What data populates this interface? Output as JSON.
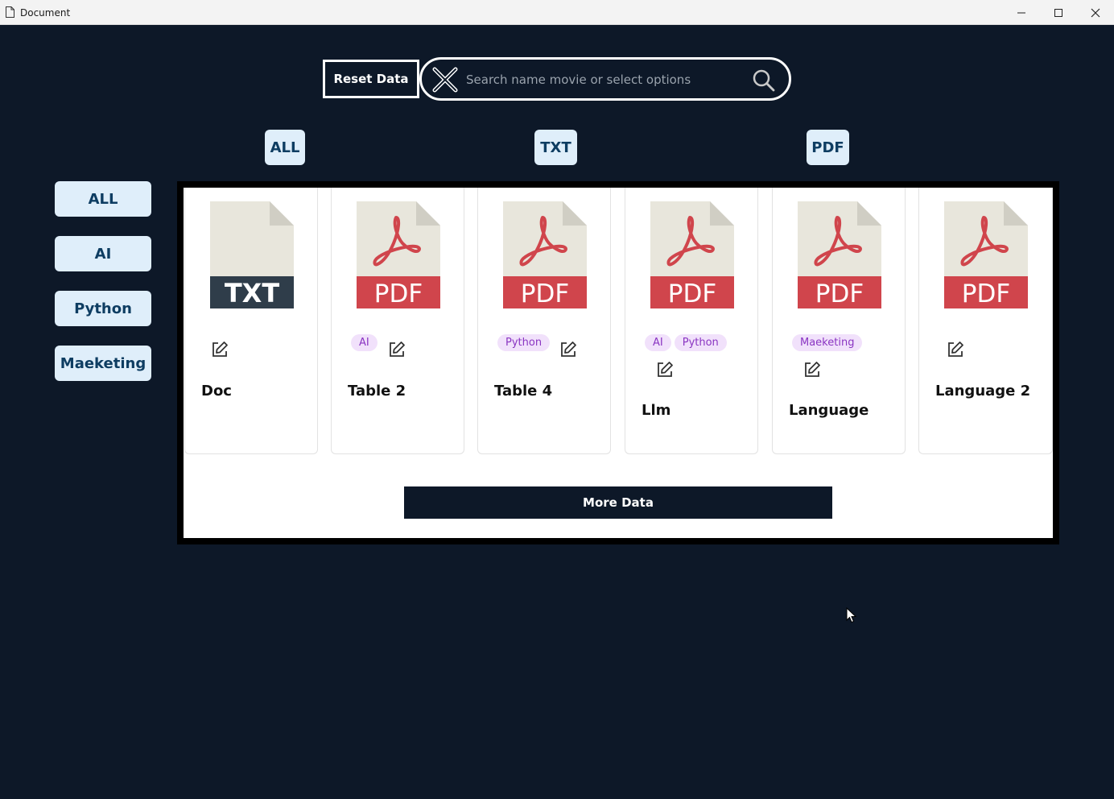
{
  "window": {
    "title": "Document"
  },
  "toolbar": {
    "reset_label": "Reset Data",
    "search_placeholder": "Search name movie or select options"
  },
  "type_tabs": [
    "ALL",
    "TXT",
    "PDF"
  ],
  "categories": [
    "ALL",
    "AI",
    "Python",
    "Maeketing"
  ],
  "cards": [
    {
      "name": "Doc",
      "file_type": "TXT",
      "tags": []
    },
    {
      "name": "Table 2",
      "file_type": "PDF",
      "tags": [
        "AI"
      ]
    },
    {
      "name": "Table 4",
      "file_type": "PDF",
      "tags": [
        "Python"
      ]
    },
    {
      "name": "Llm",
      "file_type": "PDF",
      "tags": [
        "AI",
        "Python"
      ]
    },
    {
      "name": "Language",
      "file_type": "PDF",
      "tags": [
        "Maeketing"
      ]
    },
    {
      "name": "Language 2",
      "file_type": "PDF",
      "tags": []
    }
  ],
  "more_label": "More Data",
  "colors": {
    "background": "#0d1828",
    "tab_bg": "#dfeefa",
    "tab_text": "#0e3d62",
    "pdf_red": "#d0454c",
    "txt_dark": "#2f3d4a",
    "tag_bg": "#f1e1fb",
    "tag_text": "#8a35c2"
  }
}
